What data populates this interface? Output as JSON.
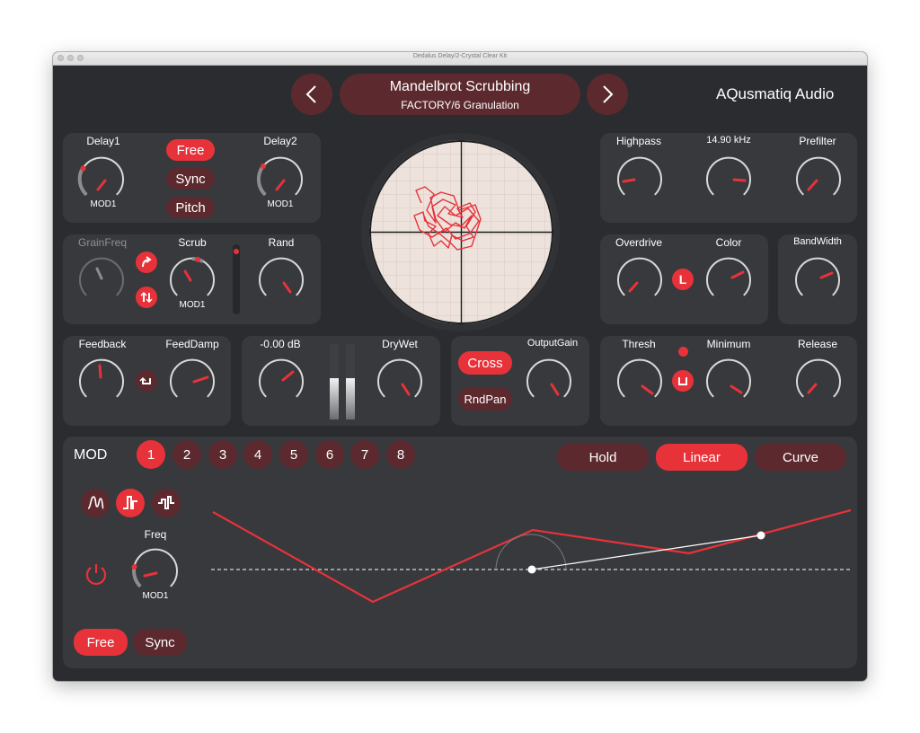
{
  "window": {
    "title": "Dedalus Delay/2-Crystal Clear Kit"
  },
  "header": {
    "preset_name": "Mandelbrot Scrubbing",
    "preset_category": "FACTORY/6 Granulation",
    "brand": "AQusmatiq Audio",
    "prev_icon": "chevron-left-icon",
    "next_icon": "chevron-right-icon"
  },
  "colors": {
    "accent": "#e8323a",
    "panel": "#37393d",
    "button_off": "#5c2a2e",
    "background": "#2a2c2f"
  },
  "delay": {
    "delay1_label": "Delay1",
    "delay1_mod": "MOD1",
    "delay2_label": "Delay2",
    "delay2_mod": "MOD1",
    "mode_buttons": [
      "Free",
      "Sync",
      "Pitch"
    ],
    "selected_mode": "Free"
  },
  "grain": {
    "grainfreq_label": "GrainFreq",
    "scrub_label": "Scrub",
    "scrub_mod": "MOD1",
    "rand_label": "Rand"
  },
  "feedback": {
    "feedback_label": "Feedback",
    "feeddamp_label": "FeedDamp"
  },
  "output": {
    "db_value": "-0.00 dB",
    "drywet_label": "DryWet"
  },
  "stereo": {
    "cross_label": "Cross",
    "rndpan_label": "RndPan",
    "outputgain_label": "OutputGain"
  },
  "filter": {
    "highpass_label": "Highpass",
    "freq_value": "14.90 kHz",
    "prefilter_label": "Prefilter"
  },
  "drive": {
    "overdrive_label": "Overdrive",
    "mode_badge": "L",
    "color_label": "Color",
    "bandwidth_label": "BandWidth"
  },
  "dynamics": {
    "thresh_label": "Thresh",
    "minimum_label": "Minimum",
    "release_label": "Release"
  },
  "mod": {
    "label": "MOD",
    "slots": [
      "1",
      "2",
      "3",
      "4",
      "5",
      "6",
      "7",
      "8"
    ],
    "selected_slot": "1",
    "interp_modes": [
      "Hold",
      "Linear",
      "Curve"
    ],
    "selected_interp": "Linear",
    "freq_label": "Freq",
    "freq_mod": "MOD1",
    "free_label": "Free",
    "sync_label": "Sync"
  }
}
